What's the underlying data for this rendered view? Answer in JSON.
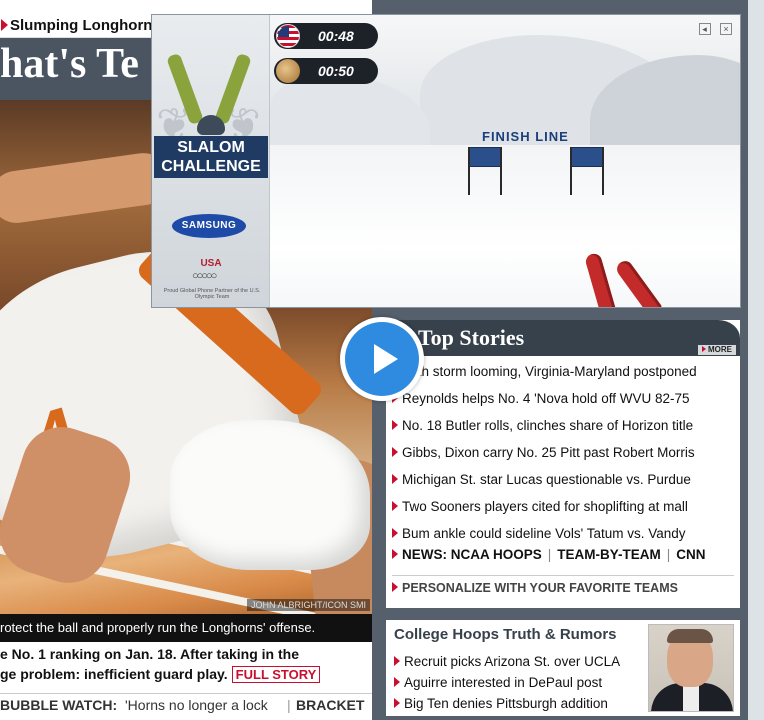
{
  "feature": {
    "kicker": "Slumping Longhorns",
    "headline": "hat's Te",
    "photo_credit": "JOHN ALBRIGHT/ICON SMI",
    "caption": "rotect the ball and properly run the Longhorns' offense.",
    "body_line1": "e No. 1 ranking on Jan. 18. After taking in the",
    "body_line2": "ge problem: inefficient guard play.",
    "full_story": "FULL STORY",
    "bubble_label": "BUBBLE WATCH:",
    "bubble_link": "'Horns no longer a lock",
    "bubble_sep": "|",
    "bracket_link": "BRACKET"
  },
  "ad": {
    "title_line1": "SLALOM",
    "title_line2": "CHALLENGE",
    "sponsor": "SAMSUNG",
    "usa_logo": "USA",
    "rings": "○○○○○",
    "fine_print": "Proud Global Phone Partner of the U.S. Olympic Team",
    "timer_player": "00:48",
    "timer_opponent": "00:50",
    "finish_label": "FINISH  LINE",
    "mute_icon": "speaker-icon",
    "close_glyph": "×"
  },
  "top_stories": {
    "title": "Top Stories",
    "more": "MORE",
    "items": [
      "With storm looming, Virginia-Maryland postponed",
      "Reynolds helps No. 4 'Nova hold off WVU 82-75",
      "No. 18 Butler rolls, clinches share of Horizon title",
      "Gibbs, Dixon carry No. 25 Pitt past Robert Morris",
      "Michigan St. star Lucas questionable vs. Purdue",
      "Two Sooners players cited for shoplifting at mall",
      "Bum ankle could sideline Vols' Tatum vs. Vandy"
    ],
    "links": [
      "NEWS: NCAA HOOPS",
      "TEAM-BY-TEAM",
      "CNN"
    ],
    "personalize": "PERSONALIZE WITH YOUR FAVORITE TEAMS"
  },
  "rumors": {
    "title": "College Hoops Truth & Rumors",
    "items": [
      "Recruit picks Arizona St. over UCLA",
      "Aguirre interested in DePaul post",
      "Big Ten denies Pittsburgh addition"
    ]
  },
  "colors": {
    "accent_red": "#c8102e",
    "header_slate": "#37414c",
    "page_bg": "#56606c",
    "play_blue": "#2f8be0"
  }
}
